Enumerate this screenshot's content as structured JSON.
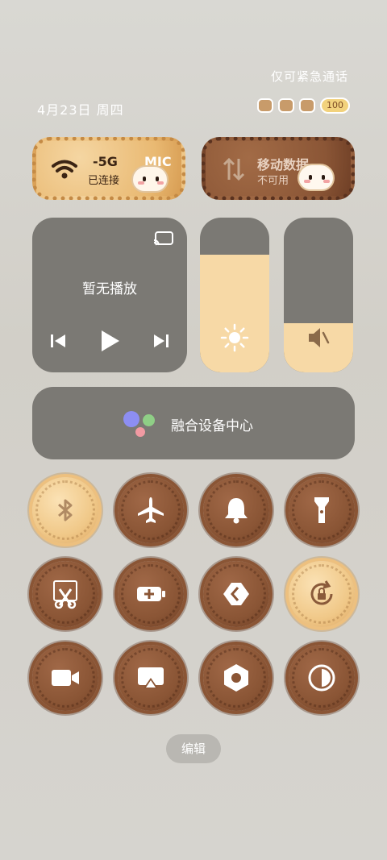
{
  "status": {
    "emergency_text": "仅可紧急通话",
    "date": "4月23日 周四",
    "battery": "100"
  },
  "tiles": {
    "wifi": {
      "title": "-5G",
      "title_tail": "MIC",
      "subtitle": "已连接"
    },
    "mobile": {
      "title": "移动数据",
      "subtitle": "不可用"
    }
  },
  "media": {
    "status": "暂无播放"
  },
  "sliders": {
    "brightness": 0.76,
    "volume": 0.32
  },
  "fusion": {
    "label": "融合设备中心"
  },
  "toggles": [
    {
      "icon": "bluetooth-icon"
    },
    {
      "icon": "airplane-icon"
    },
    {
      "icon": "bell-icon"
    },
    {
      "icon": "flashlight-icon"
    },
    {
      "icon": "screenshot-scissors-icon"
    },
    {
      "icon": "battery-saver-icon"
    },
    {
      "icon": "link-icon"
    },
    {
      "icon": "rotation-lock-icon"
    },
    {
      "icon": "screen-record-icon"
    },
    {
      "icon": "screen-cast-icon"
    },
    {
      "icon": "settings-hex-icon"
    },
    {
      "icon": "dark-mode-icon"
    }
  ],
  "edit": {
    "label": "编辑"
  }
}
